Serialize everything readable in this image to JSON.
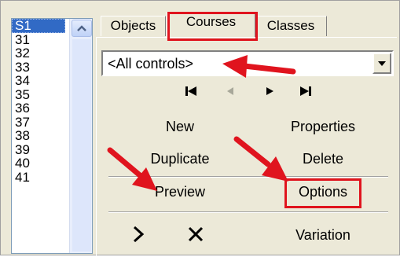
{
  "list": {
    "items": [
      "S1",
      "31",
      "32",
      "33",
      "34",
      "35",
      "36",
      "37",
      "38",
      "39",
      "40",
      "41"
    ],
    "selected_index": 0
  },
  "tabs": [
    {
      "label": "Objects",
      "active": false
    },
    {
      "label": "Courses",
      "active": true
    },
    {
      "label": "Classes",
      "active": false
    }
  ],
  "dropdown": {
    "value": "<All controls>"
  },
  "navigation": {
    "first_icon": "first-icon",
    "previous_icon": "previous-icon",
    "next_icon": "next-icon",
    "last_icon": "last-icon",
    "previous_enabled": false
  },
  "actions": {
    "new_label": "New",
    "properties_label": "Properties",
    "duplicate_label": "Duplicate",
    "delete_label": "Delete",
    "preview_label": "Preview",
    "options_label": "Options",
    "variation_label": "Variation",
    "move_icon": "chevron-right-icon",
    "remove_icon": "x-icon"
  },
  "annotations": {
    "highlight_color": "#e0141e",
    "arrow_color": "#e0141e"
  }
}
